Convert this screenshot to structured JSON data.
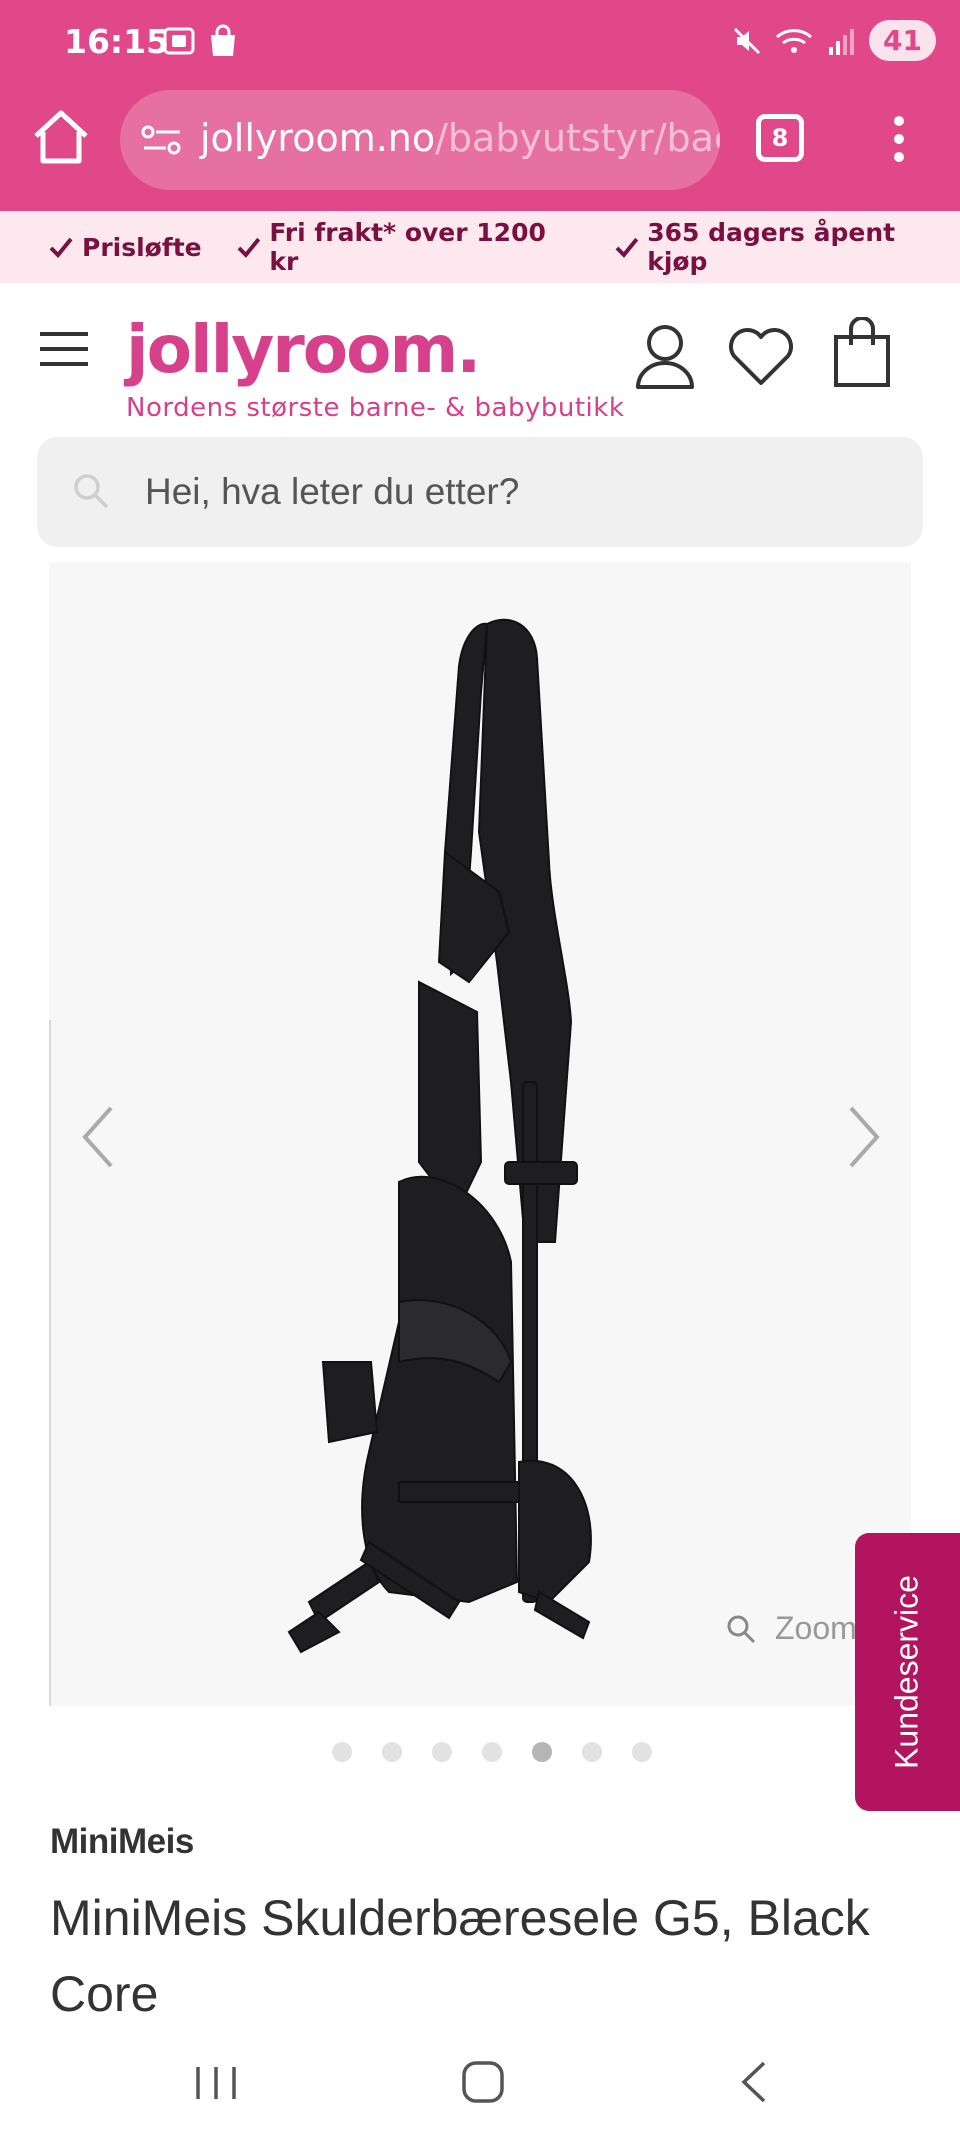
{
  "status_bar": {
    "time": "16:15",
    "battery": "41"
  },
  "browser": {
    "url_host": "jollyroom.no",
    "url_path": "/babyutstyr/baeresele",
    "tab_count": "8"
  },
  "usp": [
    "Prisløfte",
    "Fri frakt* over 1200 kr",
    "365 dagers åpent kjøp"
  ],
  "header": {
    "logo": "jollyroom.",
    "tagline": "Nordens største barne- & babybutikk"
  },
  "search": {
    "placeholder": "Hei, hva leter du etter?"
  },
  "gallery": {
    "zoom_label": "Zoom",
    "dot_count": 7,
    "active_dot": 5
  },
  "customer_service": {
    "label": "Kundeservice"
  },
  "product": {
    "brand": "MiniMeis",
    "title": "MiniMeis Skulderbæresele G5, Black Core"
  },
  "colors": {
    "brand_pink": "#e0488a",
    "usp_bg": "#fde8ef",
    "service_tab": "#b3145f"
  }
}
